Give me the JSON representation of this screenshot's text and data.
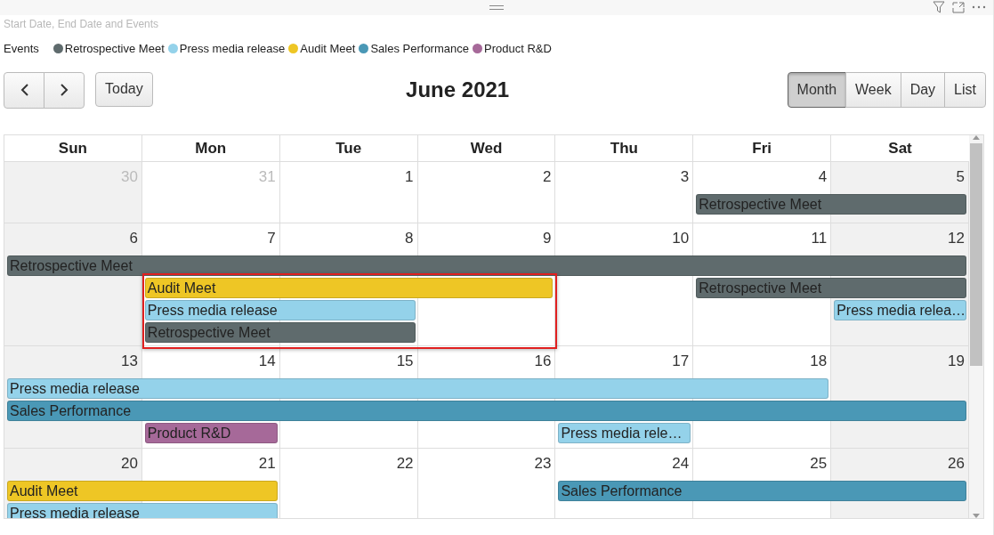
{
  "visual_title": "Start Date, End Date and Events",
  "legend": {
    "title": "Events",
    "items": [
      {
        "label": "Retrospective Meet",
        "color": "#5f6b6d"
      },
      {
        "label": "Press media release",
        "color": "#94d2ea"
      },
      {
        "label": "Audit Meet",
        "color": "#eec625"
      },
      {
        "label": "Sales Performance",
        "color": "#4a98b6"
      },
      {
        "label": "Product R&D",
        "color": "#a66999"
      }
    ]
  },
  "toolbar": {
    "today": "Today",
    "title": "June 2021",
    "views": [
      {
        "label": "Month",
        "selected": true
      },
      {
        "label": "Week",
        "selected": false
      },
      {
        "label": "Day",
        "selected": false
      },
      {
        "label": "List",
        "selected": false
      }
    ]
  },
  "columns": [
    {
      "label": "Sun",
      "weekend": true
    },
    {
      "label": "Mon",
      "weekend": false
    },
    {
      "label": "Tue",
      "weekend": false
    },
    {
      "label": "Wed",
      "weekend": false
    },
    {
      "label": "Thu",
      "weekend": false
    },
    {
      "label": "Fri",
      "weekend": false
    },
    {
      "label": "Sat",
      "weekend": true
    }
  ],
  "weeks": [
    {
      "days": [
        {
          "number": "30",
          "other_month": true
        },
        {
          "number": "31",
          "other_month": true
        },
        {
          "number": "1",
          "other_month": false
        },
        {
          "number": "2",
          "other_month": false
        },
        {
          "number": "3",
          "other_month": false
        },
        {
          "number": "4",
          "other_month": false
        },
        {
          "number": "5",
          "other_month": false
        }
      ],
      "lanes": [
        [
          {
            "title": "Retrospective Meet",
            "color": "#5f6b6d"
          }
        ]
      ],
      "highlighted": false
    },
    {
      "days": [
        {
          "number": "6",
          "other_month": false
        },
        {
          "number": "7",
          "other_month": false
        },
        {
          "number": "8",
          "other_month": false
        },
        {
          "number": "9",
          "other_month": false
        },
        {
          "number": "10",
          "other_month": false
        },
        {
          "number": "11",
          "other_month": false
        },
        {
          "number": "12",
          "other_month": false
        }
      ],
      "lanes": [
        [
          {
            "title": "Retrospective Meet",
            "color": "#5f6b6d"
          }
        ],
        [
          {
            "title": "Audit Meet",
            "color": "#eec625"
          },
          {
            "title": "Retrospective Meet",
            "color": "#5f6b6d"
          }
        ],
        [
          {
            "title": "Press media release",
            "color": "#94d2ea"
          },
          {
            "title": "Press media relea…",
            "color": "#94d2ea"
          }
        ],
        [
          {
            "title": "Retrospective Meet",
            "color": "#5f6b6d"
          }
        ]
      ],
      "highlighted": true
    },
    {
      "days": [
        {
          "number": "13",
          "other_month": false
        },
        {
          "number": "14",
          "other_month": false
        },
        {
          "number": "15",
          "other_month": false
        },
        {
          "number": "16",
          "other_month": false
        },
        {
          "number": "17",
          "other_month": false
        },
        {
          "number": "18",
          "other_month": false
        },
        {
          "number": "19",
          "other_month": false
        }
      ],
      "lanes": [
        [
          {
            "title": "Press media release",
            "color": "#94d2ea"
          }
        ],
        [
          {
            "title": "Sales Performance",
            "color": "#4a98b6"
          }
        ],
        [
          {
            "title": "Product R&D",
            "color": "#a66999"
          },
          {
            "title": "Press media rele…",
            "color": "#94d2ea"
          }
        ]
      ],
      "highlighted": false
    },
    {
      "days": [
        {
          "number": "20",
          "other_month": false
        },
        {
          "number": "21",
          "other_month": false
        },
        {
          "number": "22",
          "other_month": false
        },
        {
          "number": "23",
          "other_month": false
        },
        {
          "number": "24",
          "other_month": false
        },
        {
          "number": "25",
          "other_month": false
        },
        {
          "number": "26",
          "other_month": false
        }
      ],
      "lanes": [
        [
          {
            "title": "Audit Meet",
            "color": "#eec625"
          },
          {
            "title": "Sales Performance",
            "color": "#4a98b6"
          }
        ],
        [
          {
            "title": "Press media release",
            "color": "#94d2ea"
          }
        ]
      ],
      "highlighted": false
    }
  ]
}
